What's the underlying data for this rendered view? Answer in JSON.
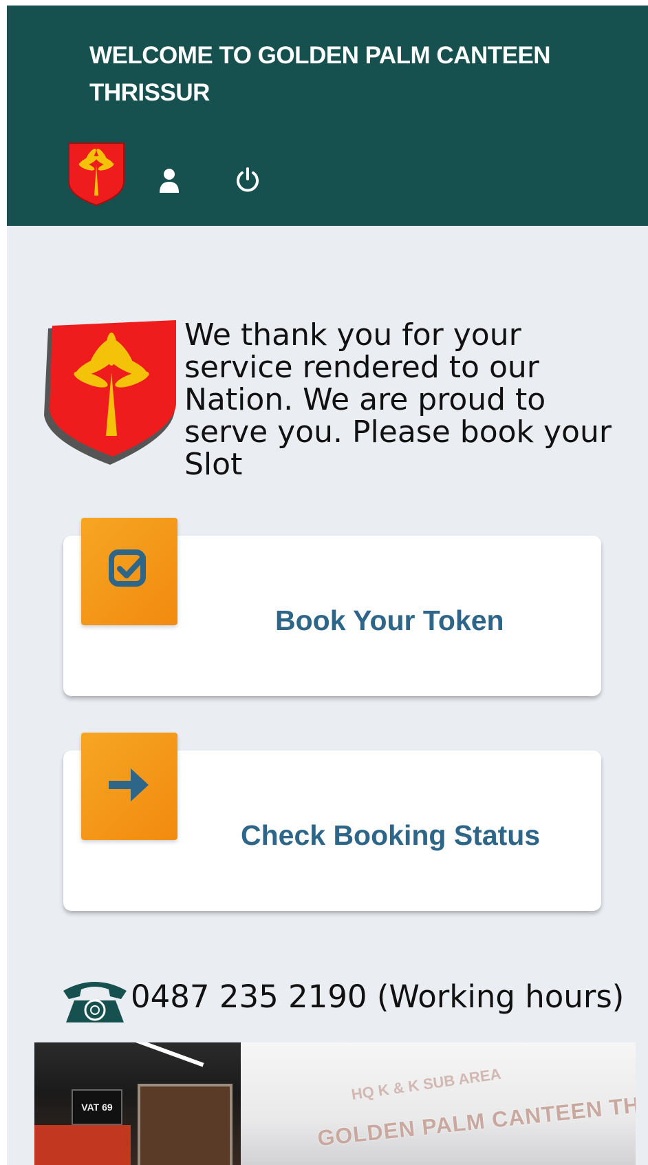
{
  "header": {
    "title": "WELCOME TO GOLDEN PALM CANTEEN THRISSUR",
    "logo_icon": "palm-shield-logo",
    "user_icon": "user-icon",
    "power_icon": "power-icon"
  },
  "welcome": {
    "logo_icon": "palm-shield-logo",
    "message": "We thank you for your service rendered to our Nation. We are proud to serve you. Please book your Slot"
  },
  "actions": [
    {
      "label": "Book Your Token",
      "icon": "checkbox-icon"
    },
    {
      "label": "Check Booking Status",
      "icon": "arrow-right-icon"
    }
  ],
  "contact": {
    "phone_text": "0487 235 2190 (Working hours)",
    "icon": "telephone-icon"
  },
  "photo": {
    "sign_text": "GOLDEN PALM CANTEEN THRISSUR",
    "sign_top_text": "HQ K & K SUB AREA",
    "shop_sign": "VAT 69"
  },
  "colors": {
    "header_bg": "#17514f",
    "page_bg": "#eaedf2",
    "accent_orange": "#f6a623",
    "label_blue": "#2d6688",
    "shield_red": "#ee1c1c",
    "palm_gold": "#f5c20a"
  }
}
